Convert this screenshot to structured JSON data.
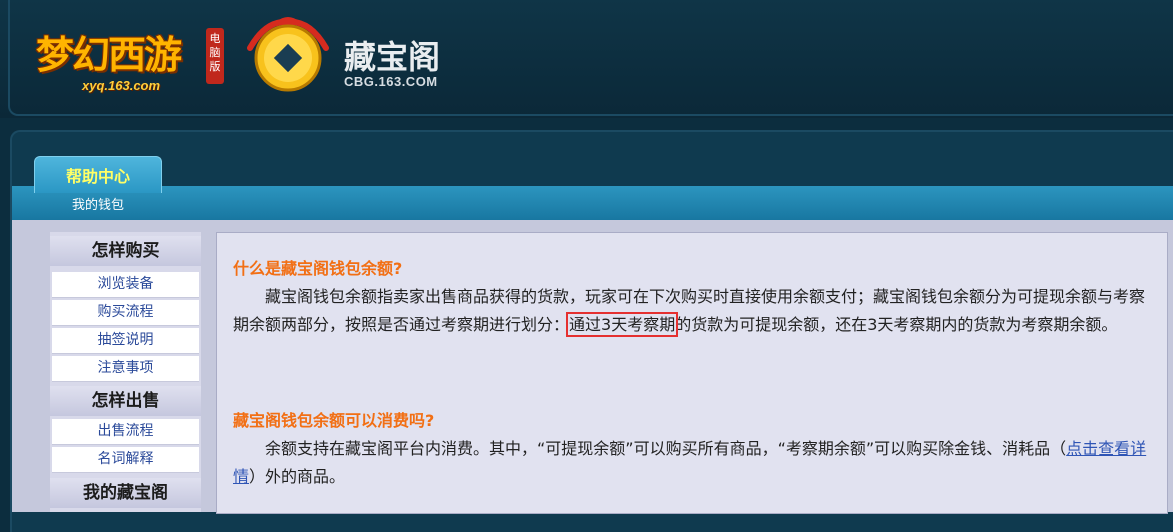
{
  "header": {
    "game_logo_text": "梦幻西游",
    "game_badge": "电脑版",
    "game_url": "xyq.163.com",
    "site_name": "藏宝阁",
    "site_domain": "CBG.163.COM"
  },
  "tabs": {
    "active": "帮助中心",
    "sub": "我的钱包"
  },
  "sidebar": {
    "sections": [
      {
        "title": "怎样购买",
        "items": [
          "浏览装备",
          "购买流程",
          "抽签说明",
          "注意事项"
        ]
      },
      {
        "title": "怎样出售",
        "items": [
          "出售流程",
          "名词解释"
        ]
      },
      {
        "title": "我的藏宝阁",
        "items": []
      }
    ]
  },
  "content": {
    "q1": "什么是藏宝阁钱包余额?",
    "p1_a": "藏宝阁钱包余额指卖家出售商品获得的货款，玩家可在下次购买时直接使用余额支付；藏宝阁钱包余额分为可提现余额与考察期余额两部分，按照是否通过考察期进行划分：",
    "p1_highlight": "通过3天考察期",
    "p1_b": "的货款为可提现余额，还在3天考察期内的货款为考察期余额。",
    "q2": "藏宝阁钱包余额可以消费吗?",
    "p2_a": "余额支持在藏宝阁平台内消费。其中，“可提现余额”可以购买所有商品，“考察期余额”可以购买除金钱、消耗品（",
    "p2_link": "点击查看详情",
    "p2_b": "）外的商品。"
  },
  "colors": {
    "question": "#f26f14",
    "tab_label": "#ffff66",
    "link": "#2f55b5",
    "highlight_box": "#e53030"
  }
}
